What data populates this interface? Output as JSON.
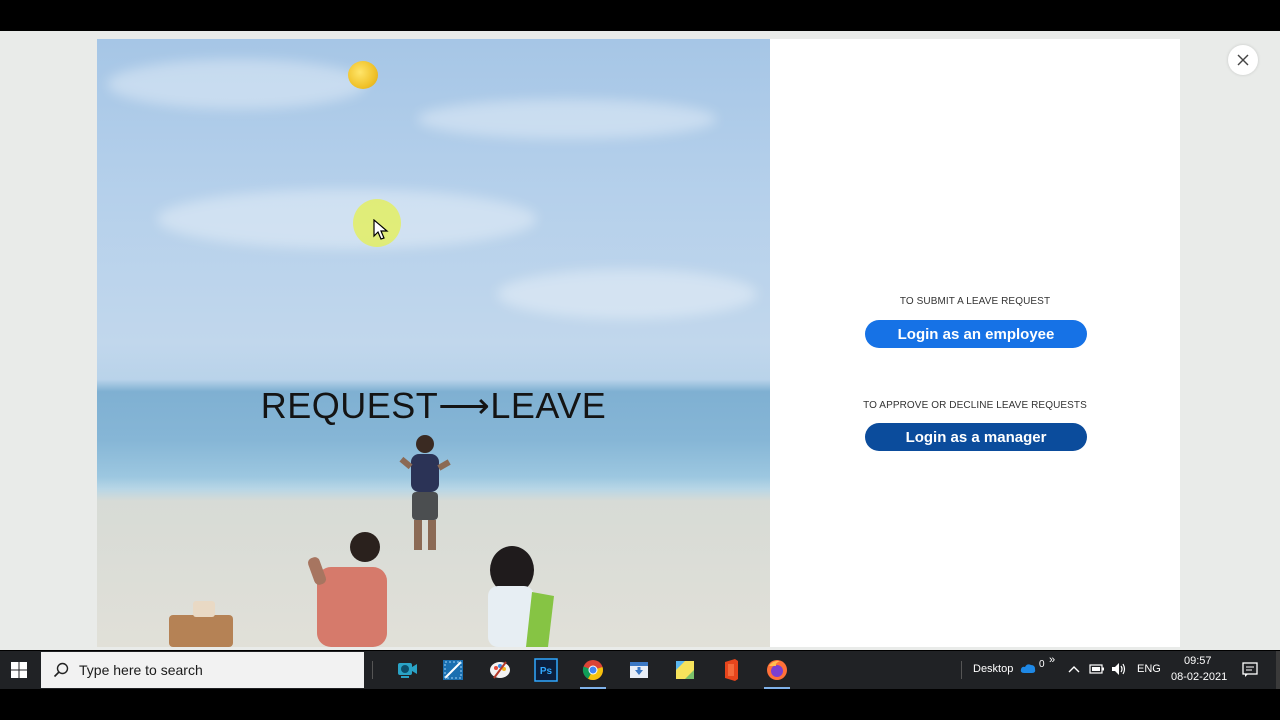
{
  "hero": {
    "title": "REQUEST⟶LEAVE"
  },
  "login": {
    "employee_caption": "TO SUBMIT A LEAVE REQUEST",
    "employee_button": "Login as an employee",
    "manager_caption": "TO APPROVE OR DECLINE LEAVE REQUESTS",
    "manager_button": "Login as a manager"
  },
  "taskbar": {
    "search_placeholder": "Type here to search",
    "desktop_label": "Desktop",
    "onedrive_badge": "0",
    "language": "ENG",
    "time": "09:57",
    "date": "08-02-2021",
    "apps": [
      "webcam-icon",
      "snipping-tool-icon",
      "paint-icon",
      "photoshop-icon",
      "chrome-icon",
      "downloads-icon",
      "sticky-notes-icon",
      "office-icon",
      "firefox-icon"
    ]
  },
  "colors": {
    "employee_button": "#1672e6",
    "manager_button": "#0b4c9c",
    "taskbar": "#202225"
  }
}
